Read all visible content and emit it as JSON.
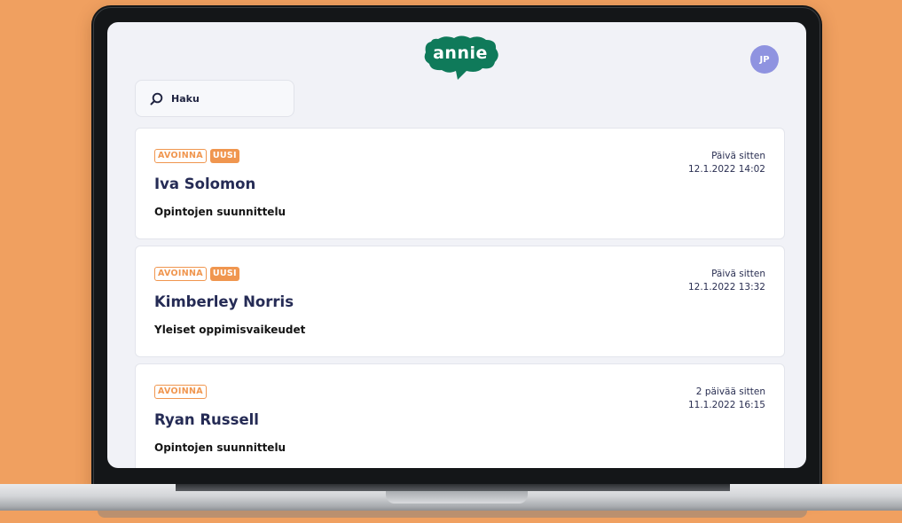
{
  "app": {
    "logo_text": "annie",
    "logo_color": "#0f7a5a",
    "user_initials": "JP",
    "avatar_color": "#8f93e0"
  },
  "search": {
    "label": "Haku",
    "icon": "search-icon"
  },
  "colors": {
    "accent": "#f0964f",
    "name_text": "#252b55",
    "screen_bg": "#f1f2f7"
  },
  "conversations": [
    {
      "status": "AVOINNA",
      "new_label": "UUSI",
      "name": "Iva Solomon",
      "topic": "Opintojen suunnittelu",
      "relative_time": "Päivä sitten",
      "timestamp": "12.1.2022 14:02"
    },
    {
      "status": "AVOINNA",
      "new_label": "UUSI",
      "name": "Kimberley Norris",
      "topic": "Yleiset oppimisvaikeudet",
      "relative_time": "Päivä sitten",
      "timestamp": "12.1.2022 13:32"
    },
    {
      "status": "AVOINNA",
      "new_label": null,
      "name": "Ryan Russell",
      "topic": "Opintojen suunnittelu",
      "relative_time": "2 päivää sitten",
      "timestamp": "11.1.2022 16:15"
    }
  ]
}
